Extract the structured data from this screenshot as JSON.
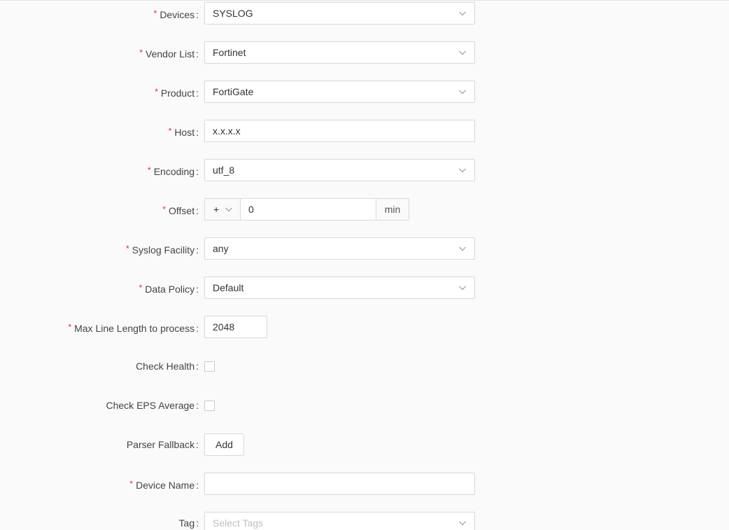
{
  "form": {
    "devices": {
      "label": "Devices",
      "value": "SYSLOG",
      "required": true
    },
    "vendor_list": {
      "label": "Vendor List",
      "value": "Fortinet",
      "required": true
    },
    "product": {
      "label": "Product",
      "value": "FortiGate",
      "required": true
    },
    "host": {
      "label": "Host",
      "value": "x.x.x.x",
      "required": true
    },
    "encoding": {
      "label": "Encoding",
      "value": "utf_8",
      "required": true
    },
    "offset": {
      "label": "Offset",
      "sign": "+",
      "value": "0",
      "unit": "min",
      "required": true
    },
    "syslog_facility": {
      "label": "Syslog Facility",
      "value": "any",
      "required": true
    },
    "data_policy": {
      "label": "Data Policy",
      "value": "Default",
      "required": true
    },
    "max_line_length": {
      "label": "Max Line Length to process",
      "value": "2048",
      "required": true
    },
    "check_health": {
      "label": "Check Health",
      "checked": false
    },
    "check_eps_average": {
      "label": "Check EPS Average",
      "checked": false
    },
    "parser_fallback": {
      "label": "Parser Fallback",
      "button_label": "Add"
    },
    "device_name": {
      "label": "Device Name",
      "value": "",
      "required": true
    },
    "tag": {
      "label": "Tag",
      "placeholder": "Select Tags"
    }
  },
  "symbols": {
    "required_mark": "*",
    "colon": ":"
  },
  "icons": {
    "dropdown": "chevron-down-icon"
  },
  "colors": {
    "required": "#f5222d",
    "border": "#d9d9d9",
    "background": "#fafafa"
  }
}
